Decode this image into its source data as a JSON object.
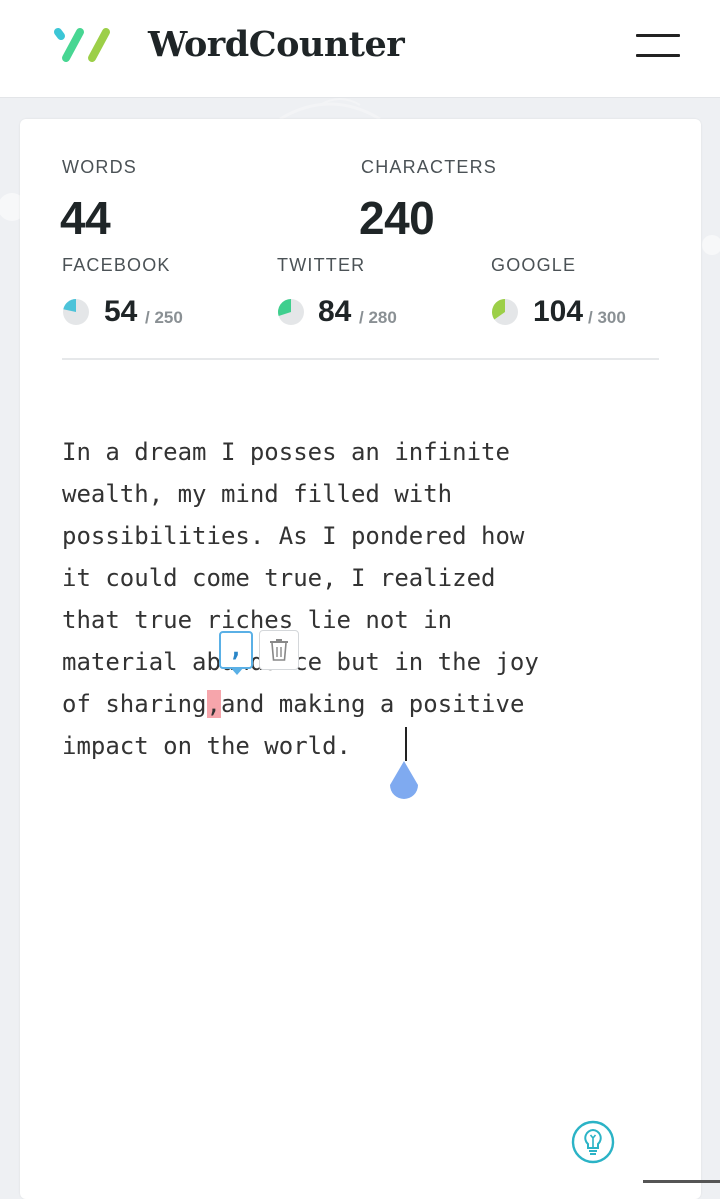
{
  "header": {
    "brand": "WordCounter",
    "logo_colors": [
      "#3cc6d6",
      "#47d692",
      "#9ccf48"
    ]
  },
  "stats": {
    "words_label": "WORDS",
    "words_value": "44",
    "characters_label": "CHARACTERS",
    "characters_value": "240"
  },
  "social": [
    {
      "label": "FACEBOOK",
      "value": "54",
      "max": "/ 250",
      "fill": 0.216,
      "color": "#4cc3d9"
    },
    {
      "label": "TWITTER",
      "value": "84",
      "max": "/ 280",
      "fill": 0.3,
      "color": "#3fcf8e"
    },
    {
      "label": "GOOGLE",
      "value": "104",
      "max": "/ 300",
      "fill": 0.347,
      "color": "#9ccf48"
    }
  ],
  "editor": {
    "lines": [
      "In a dream I posses an infinite",
      "wealth, my mind filled with",
      "possibilities. As I pondered how",
      "it could come true, I realized",
      "that true riches lie not in",
      "material abundance but in the joy",
      "of sharing",
      ",",
      "and making a positive",
      "impact on the world."
    ]
  },
  "popup": {
    "suggestion": ","
  }
}
